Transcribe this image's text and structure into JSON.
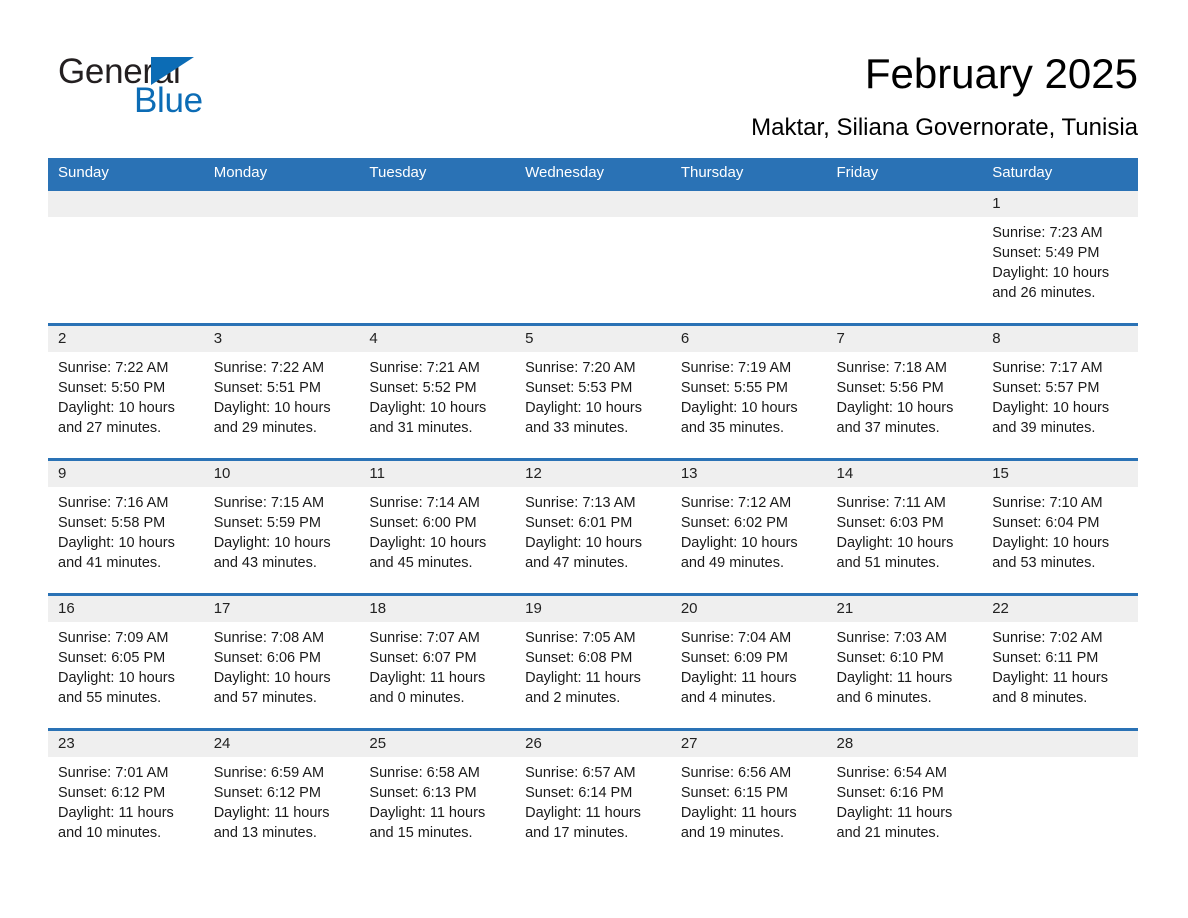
{
  "brand": {
    "name_part1": "General",
    "name_part2": "Blue",
    "triangle_color": "#0c6cb5",
    "text_color": "#231f20"
  },
  "header": {
    "title": "February 2025",
    "subtitle": "Maktar, Siliana Governorate, Tunisia"
  },
  "theme": {
    "header_blue": "#2a72b5",
    "daynum_band": "#efefef",
    "page_bg": "#ffffff",
    "text": "#1a1a1a"
  },
  "calendar": {
    "weekday_headers": [
      "Sunday",
      "Monday",
      "Tuesday",
      "Wednesday",
      "Thursday",
      "Friday",
      "Saturday"
    ],
    "weeks": [
      [
        {
          "day": "",
          "sunrise": "",
          "sunset": "",
          "daylight_line1": "",
          "daylight_line2": ""
        },
        {
          "day": "",
          "sunrise": "",
          "sunset": "",
          "daylight_line1": "",
          "daylight_line2": ""
        },
        {
          "day": "",
          "sunrise": "",
          "sunset": "",
          "daylight_line1": "",
          "daylight_line2": ""
        },
        {
          "day": "",
          "sunrise": "",
          "sunset": "",
          "daylight_line1": "",
          "daylight_line2": ""
        },
        {
          "day": "",
          "sunrise": "",
          "sunset": "",
          "daylight_line1": "",
          "daylight_line2": ""
        },
        {
          "day": "",
          "sunrise": "",
          "sunset": "",
          "daylight_line1": "",
          "daylight_line2": ""
        },
        {
          "day": "1",
          "sunrise": "Sunrise: 7:23 AM",
          "sunset": "Sunset: 5:49 PM",
          "daylight_line1": "Daylight: 10 hours",
          "daylight_line2": "and 26 minutes."
        }
      ],
      [
        {
          "day": "2",
          "sunrise": "Sunrise: 7:22 AM",
          "sunset": "Sunset: 5:50 PM",
          "daylight_line1": "Daylight: 10 hours",
          "daylight_line2": "and 27 minutes."
        },
        {
          "day": "3",
          "sunrise": "Sunrise: 7:22 AM",
          "sunset": "Sunset: 5:51 PM",
          "daylight_line1": "Daylight: 10 hours",
          "daylight_line2": "and 29 minutes."
        },
        {
          "day": "4",
          "sunrise": "Sunrise: 7:21 AM",
          "sunset": "Sunset: 5:52 PM",
          "daylight_line1": "Daylight: 10 hours",
          "daylight_line2": "and 31 minutes."
        },
        {
          "day": "5",
          "sunrise": "Sunrise: 7:20 AM",
          "sunset": "Sunset: 5:53 PM",
          "daylight_line1": "Daylight: 10 hours",
          "daylight_line2": "and 33 minutes."
        },
        {
          "day": "6",
          "sunrise": "Sunrise: 7:19 AM",
          "sunset": "Sunset: 5:55 PM",
          "daylight_line1": "Daylight: 10 hours",
          "daylight_line2": "and 35 minutes."
        },
        {
          "day": "7",
          "sunrise": "Sunrise: 7:18 AM",
          "sunset": "Sunset: 5:56 PM",
          "daylight_line1": "Daylight: 10 hours",
          "daylight_line2": "and 37 minutes."
        },
        {
          "day": "8",
          "sunrise": "Sunrise: 7:17 AM",
          "sunset": "Sunset: 5:57 PM",
          "daylight_line1": "Daylight: 10 hours",
          "daylight_line2": "and 39 minutes."
        }
      ],
      [
        {
          "day": "9",
          "sunrise": "Sunrise: 7:16 AM",
          "sunset": "Sunset: 5:58 PM",
          "daylight_line1": "Daylight: 10 hours",
          "daylight_line2": "and 41 minutes."
        },
        {
          "day": "10",
          "sunrise": "Sunrise: 7:15 AM",
          "sunset": "Sunset: 5:59 PM",
          "daylight_line1": "Daylight: 10 hours",
          "daylight_line2": "and 43 minutes."
        },
        {
          "day": "11",
          "sunrise": "Sunrise: 7:14 AM",
          "sunset": "Sunset: 6:00 PM",
          "daylight_line1": "Daylight: 10 hours",
          "daylight_line2": "and 45 minutes."
        },
        {
          "day": "12",
          "sunrise": "Sunrise: 7:13 AM",
          "sunset": "Sunset: 6:01 PM",
          "daylight_line1": "Daylight: 10 hours",
          "daylight_line2": "and 47 minutes."
        },
        {
          "day": "13",
          "sunrise": "Sunrise: 7:12 AM",
          "sunset": "Sunset: 6:02 PM",
          "daylight_line1": "Daylight: 10 hours",
          "daylight_line2": "and 49 minutes."
        },
        {
          "day": "14",
          "sunrise": "Sunrise: 7:11 AM",
          "sunset": "Sunset: 6:03 PM",
          "daylight_line1": "Daylight: 10 hours",
          "daylight_line2": "and 51 minutes."
        },
        {
          "day": "15",
          "sunrise": "Sunrise: 7:10 AM",
          "sunset": "Sunset: 6:04 PM",
          "daylight_line1": "Daylight: 10 hours",
          "daylight_line2": "and 53 minutes."
        }
      ],
      [
        {
          "day": "16",
          "sunrise": "Sunrise: 7:09 AM",
          "sunset": "Sunset: 6:05 PM",
          "daylight_line1": "Daylight: 10 hours",
          "daylight_line2": "and 55 minutes."
        },
        {
          "day": "17",
          "sunrise": "Sunrise: 7:08 AM",
          "sunset": "Sunset: 6:06 PM",
          "daylight_line1": "Daylight: 10 hours",
          "daylight_line2": "and 57 minutes."
        },
        {
          "day": "18",
          "sunrise": "Sunrise: 7:07 AM",
          "sunset": "Sunset: 6:07 PM",
          "daylight_line1": "Daylight: 11 hours",
          "daylight_line2": "and 0 minutes."
        },
        {
          "day": "19",
          "sunrise": "Sunrise: 7:05 AM",
          "sunset": "Sunset: 6:08 PM",
          "daylight_line1": "Daylight: 11 hours",
          "daylight_line2": "and 2 minutes."
        },
        {
          "day": "20",
          "sunrise": "Sunrise: 7:04 AM",
          "sunset": "Sunset: 6:09 PM",
          "daylight_line1": "Daylight: 11 hours",
          "daylight_line2": "and 4 minutes."
        },
        {
          "day": "21",
          "sunrise": "Sunrise: 7:03 AM",
          "sunset": "Sunset: 6:10 PM",
          "daylight_line1": "Daylight: 11 hours",
          "daylight_line2": "and 6 minutes."
        },
        {
          "day": "22",
          "sunrise": "Sunrise: 7:02 AM",
          "sunset": "Sunset: 6:11 PM",
          "daylight_line1": "Daylight: 11 hours",
          "daylight_line2": "and 8 minutes."
        }
      ],
      [
        {
          "day": "23",
          "sunrise": "Sunrise: 7:01 AM",
          "sunset": "Sunset: 6:12 PM",
          "daylight_line1": "Daylight: 11 hours",
          "daylight_line2": "and 10 minutes."
        },
        {
          "day": "24",
          "sunrise": "Sunrise: 6:59 AM",
          "sunset": "Sunset: 6:12 PM",
          "daylight_line1": "Daylight: 11 hours",
          "daylight_line2": "and 13 minutes."
        },
        {
          "day": "25",
          "sunrise": "Sunrise: 6:58 AM",
          "sunset": "Sunset: 6:13 PM",
          "daylight_line1": "Daylight: 11 hours",
          "daylight_line2": "and 15 minutes."
        },
        {
          "day": "26",
          "sunrise": "Sunrise: 6:57 AM",
          "sunset": "Sunset: 6:14 PM",
          "daylight_line1": "Daylight: 11 hours",
          "daylight_line2": "and 17 minutes."
        },
        {
          "day": "27",
          "sunrise": "Sunrise: 6:56 AM",
          "sunset": "Sunset: 6:15 PM",
          "daylight_line1": "Daylight: 11 hours",
          "daylight_line2": "and 19 minutes."
        },
        {
          "day": "28",
          "sunrise": "Sunrise: 6:54 AM",
          "sunset": "Sunset: 6:16 PM",
          "daylight_line1": "Daylight: 11 hours",
          "daylight_line2": "and 21 minutes."
        },
        {
          "day": "",
          "sunrise": "",
          "sunset": "",
          "daylight_line1": "",
          "daylight_line2": ""
        }
      ]
    ]
  }
}
